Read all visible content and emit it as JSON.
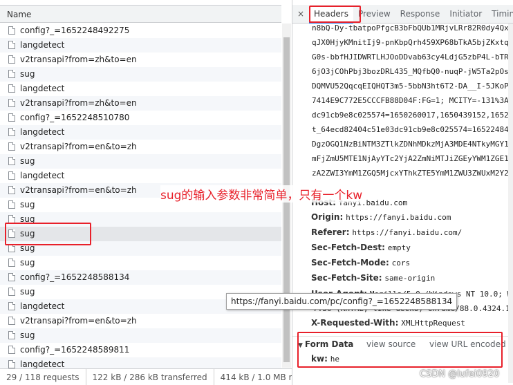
{
  "request_list": {
    "column_header": "Name",
    "rows": [
      {
        "name": "config?_=1652248492275"
      },
      {
        "name": "langdetect"
      },
      {
        "name": "v2transapi?from=zh&to=en"
      },
      {
        "name": "sug"
      },
      {
        "name": "langdetect"
      },
      {
        "name": "v2transapi?from=zh&to=en"
      },
      {
        "name": "config?_=1652248510780"
      },
      {
        "name": "langdetect"
      },
      {
        "name": "v2transapi?from=en&to=zh"
      },
      {
        "name": "sug"
      },
      {
        "name": "langdetect"
      },
      {
        "name": "v2transapi?from=en&to=zh"
      },
      {
        "name": "sug"
      },
      {
        "name": "sug"
      },
      {
        "name": "sug"
      },
      {
        "name": "sug"
      },
      {
        "name": "sug"
      },
      {
        "name": "config?_=1652248588134"
      },
      {
        "name": "sug"
      },
      {
        "name": "langdetect"
      },
      {
        "name": "v2transapi?from=en&to=zh"
      },
      {
        "name": "sug"
      },
      {
        "name": "config?_=1652248589811"
      },
      {
        "name": "langdetect"
      }
    ]
  },
  "status_bar": {
    "requests": "29 / 118 requests",
    "transferred": "122 kB / 286 kB transferred",
    "resources": "414 kB / 1.0 MB resources"
  },
  "detail": {
    "close_label": "×",
    "tabs": [
      "Headers",
      "Preview",
      "Response",
      "Initiator",
      "Timing"
    ],
    "hex_lines": [
      "n8bQ-Dy-tbatpoPfgcB3bFbQUb1MRjvLRr82R0dy4QxK",
      "qJX0HjyKMnitIj9-pnKbpQrh459XP68bTkA5bjZKxtq3",
      "G0s-bbfHJIDWRTLHJOoDDvab63cy4LdjG5zbP4L-bTR3",
      "6jO3jCOhPbj3bozDRL435_MQfbQ0-nuqP-jW5Ta2pOsQ",
      "DQMVU52QqcqEIQHQT3m5-5bbN3ht6T2-DA__I-5JKoP;",
      "7414E9C772E5CCCFB88D04F:FG=1; MCITY=-131%3A;",
      "dc91cb9e8c025574=1650260017,1650439152,165207",
      "t_64ecd82404c51e03dc91cb9e8c025574=165224848",
      "DgzOGQ1NzBiNTM3ZTlkZDNhMDkzMjA3MDE4NTkyMGY1N",
      "mFjZmU5MTE1NjAyYTc2YjA2ZmNiMTJiZGEyYWM1ZGE1Y",
      "zA2ZWI3YmM1ZGQ5MjcxYThkZTE5YmM1ZWU3ZWUxM2Y2N"
    ],
    "headers": [
      {
        "key": "Host:",
        "value": "fanyi.baidu.com"
      },
      {
        "key": "Origin:",
        "value": "https://fanyi.baidu.com"
      },
      {
        "key": "Referer:",
        "value": "https://fanyi.baidu.com/"
      },
      {
        "key": "Sec-Fetch-Dest:",
        "value": "empty"
      },
      {
        "key": "Sec-Fetch-Mode:",
        "value": "cors"
      },
      {
        "key": "Sec-Fetch-Site:",
        "value": "same-origin"
      },
      {
        "key": "User-Agent:",
        "value": "Mozilla/5.0 (Windows NT 10.0; Win64"
      },
      {
        "key": "",
        "value": "7.36 (KHTML, like Gecko) Chrome/88.0.4324.190"
      },
      {
        "key": "X-Requested-With:",
        "value": "XMLHttpRequest"
      }
    ],
    "form_data": {
      "title": "Form Data",
      "view_source": "view source",
      "view_url_encoded": "view URL encoded",
      "key": "kw:",
      "value": "he"
    }
  },
  "tooltip": "https://fanyi.baidu.com/pc/config?_=1652248588134",
  "annotation": "sug的输入参数非常简单，只有一个kw",
  "watermark": "CSDN @lufei0920",
  "colors": {
    "annotation_red": "#e8202a",
    "selected_row": "#e4e6e9",
    "tab_underline": "#1a73e8"
  },
  "selected_row_index": 14
}
